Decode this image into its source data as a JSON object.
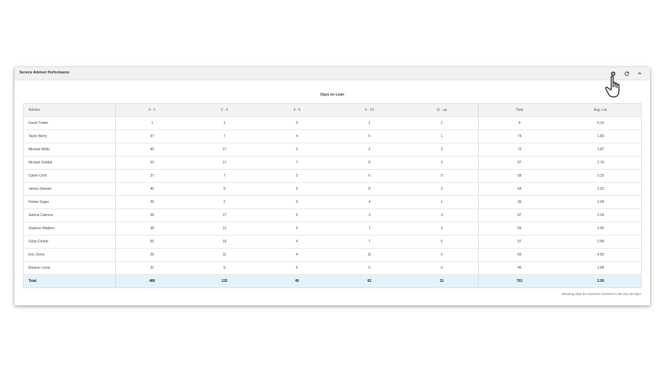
{
  "card": {
    "title": "Service Advisor Performance",
    "icons": [
      "gear-icon",
      "refresh-icon",
      "chevron-up-icon"
    ]
  },
  "table": {
    "group_header": "Days on Loan",
    "columns": [
      "Advisor",
      "0 - 1",
      "2 - 3",
      "4 - 5",
      "6 - 10",
      "11 - up",
      "Total",
      "Avg. LoL"
    ],
    "rows": [
      [
        "David Trotter",
        "1",
        "1",
        "0",
        "1",
        "1",
        "4",
        "5.15"
      ],
      [
        "Taylor Berry",
        "57",
        "7",
        "4",
        "5",
        "1",
        "74",
        "1.80"
      ],
      [
        "Michael Wells",
        "49",
        "17",
        "2",
        "2",
        "2",
        "72",
        "1.87"
      ],
      [
        "Michael Dobbin",
        "52",
        "17",
        "7",
        "8",
        "3",
        "87",
        "2.76"
      ],
      [
        "Calvin Croft",
        "37",
        "7",
        "3",
        "6",
        "5",
        "58",
        "3.33"
      ],
      [
        "James Stewart",
        "40",
        "9",
        "5",
        "8",
        "2",
        "64",
        "2.52"
      ],
      [
        "Hunter Eager",
        "29",
        "2",
        "3",
        "4",
        "1",
        "39",
        "2.08"
      ],
      [
        "Selena Cabrera",
        "58",
        "17",
        "6",
        "3",
        "3",
        "87",
        "2.24"
      ],
      [
        "Stephen Watkins",
        "38",
        "12",
        "5",
        "7",
        "3",
        "65",
        "2.96"
      ],
      [
        "Dylan Dexter",
        "65",
        "16",
        "4",
        "7",
        "5",
        "97",
        "2.58"
      ],
      [
        "Eric Jones",
        "29",
        "11",
        "4",
        "11",
        "5",
        "60",
        "4.55"
      ],
      [
        "Eleanor Lewis",
        "31",
        "9",
        "6",
        "0",
        "0",
        "46",
        "1.68"
      ]
    ],
    "total": [
      "Total",
      "486",
      "125",
      "49",
      "62",
      "31",
      "753",
      "2.59"
    ]
  },
  "footnote": "Showing data for contracts finished in the last 30 days",
  "colors": {
    "header_bg": "#f1f1f2",
    "total_row_bg": "#e4f3fb",
    "text": "#333333"
  }
}
